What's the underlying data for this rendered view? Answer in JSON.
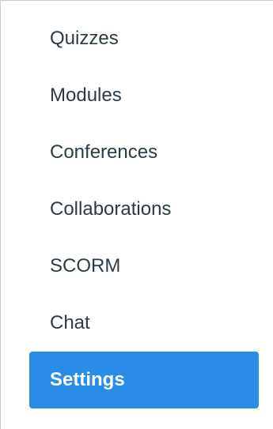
{
  "course_nav": {
    "items": [
      {
        "label": "Quizzes",
        "active": false
      },
      {
        "label": "Modules",
        "active": false
      },
      {
        "label": "Conferences",
        "active": false
      },
      {
        "label": "Collaborations",
        "active": false
      },
      {
        "label": "SCORM",
        "active": false
      },
      {
        "label": "Chat",
        "active": false
      },
      {
        "label": "Settings",
        "active": true
      }
    ],
    "active_color": "#2b8ce8",
    "text_color": "#2d3b45"
  }
}
